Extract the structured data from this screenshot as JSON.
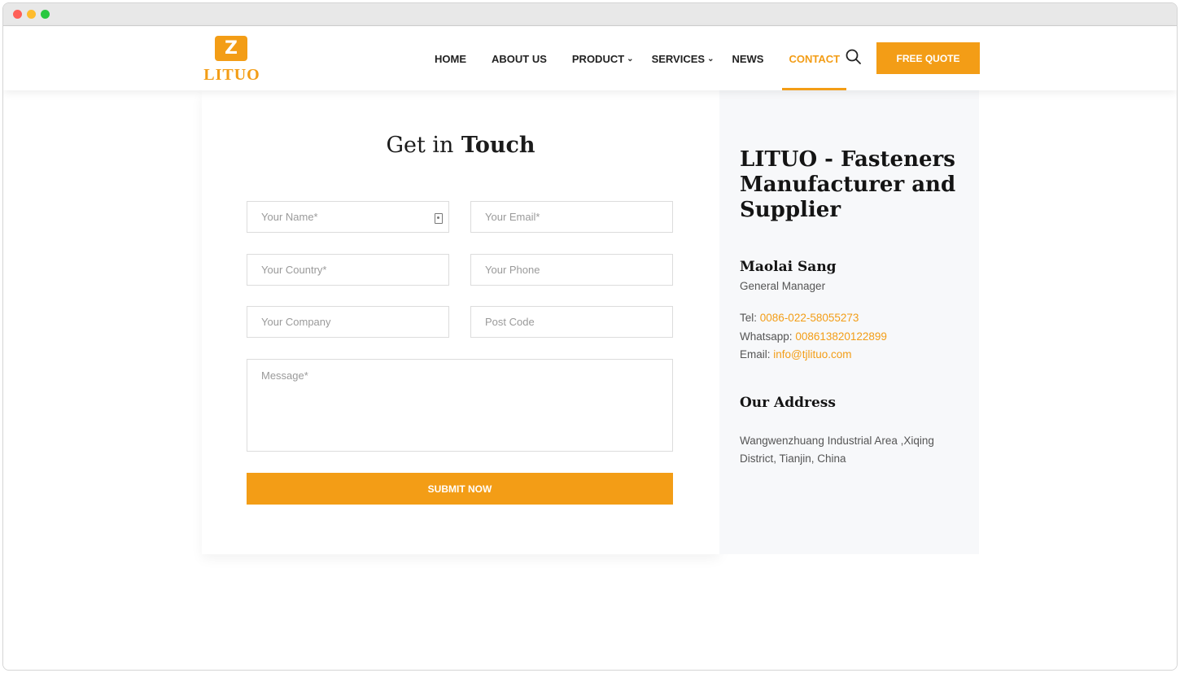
{
  "window": {
    "controls": [
      "close",
      "minimize",
      "maximize"
    ]
  },
  "brand": {
    "name": "LITUO",
    "logo_mark": "Z",
    "accent_color": "#f39d16"
  },
  "nav": {
    "items": [
      {
        "label": "HOME"
      },
      {
        "label": "ABOUT US"
      },
      {
        "label": "PRODUCT",
        "has_dropdown": true
      },
      {
        "label": "SERVICES",
        "has_dropdown": true
      },
      {
        "label": "NEWS"
      },
      {
        "label": "CONTACT",
        "active": true
      }
    ],
    "search_icon": "search-icon",
    "quote_label": "FREE QUOTE"
  },
  "form": {
    "title_light": "Get in",
    "title_bold": "Touch",
    "fields": {
      "name": "Your Name*",
      "email": "Your Email*",
      "country": "Your Country*",
      "phone": "Your Phone",
      "company": "Your Company",
      "postcode": "Post Code",
      "message": "Message*"
    },
    "submit_label": "SUBMIT NOW"
  },
  "info": {
    "company": "LITUO - Fasteners Manufacturer and Supplier",
    "person_name": "Maolai Sang",
    "person_role": "General Manager",
    "tel_label": "Tel:",
    "tel": "0086-022-58055273",
    "whatsapp_label": "Whatsapp:",
    "whatsapp": "008613820122899",
    "email_label": "Email:",
    "email": "info@tjlituo.com",
    "address_title": "Our Address",
    "address": "Wangwenzhuang Industrial Area ,Xiqing District, Tianjin, China"
  }
}
